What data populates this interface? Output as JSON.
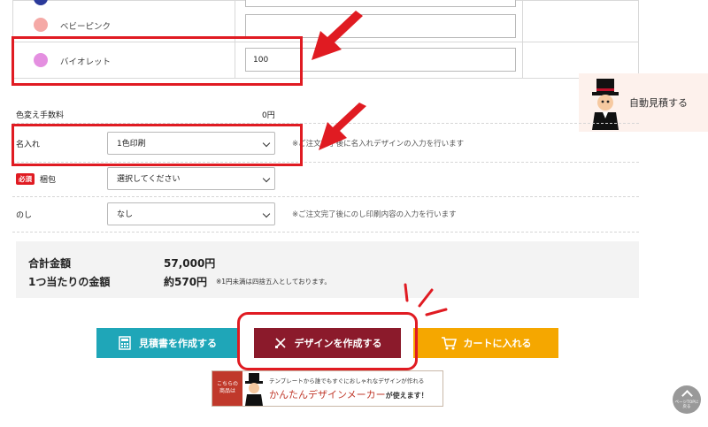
{
  "colors": {
    "rows": [
      {
        "name": "ベビーピンク",
        "swatch": "#f5a9a6",
        "value": ""
      },
      {
        "name": "バイオレット",
        "swatch": "#e48fe0",
        "value": "100"
      }
    ],
    "top_swatch": "#2b3a9a"
  },
  "auto_estimate": {
    "label": "自動見積する"
  },
  "form": {
    "fee_label": "色変え手数料",
    "fee_value": "0円",
    "print_label": "名入れ",
    "print_value": "1色印刷",
    "print_note": "※ご注文完了後に名入れデザインの入力を行います",
    "required_badge": "必須",
    "packing_label": "梱包",
    "packing_value": "選択してください",
    "noshi_label": "のし",
    "noshi_value": "なし",
    "noshi_note": "※ご注文完了後にのし印刷内容の入力を行います"
  },
  "summary": {
    "total_label": "合計金額",
    "total_value": "57,000円",
    "unit_label": "1つ当たりの金額",
    "unit_value": "約570円",
    "unit_note": "※1円未満は四捨五入としております。"
  },
  "buttons": {
    "estimate": "見積書を作成する",
    "design": "デザインを作成する",
    "cart": "カートに入れる"
  },
  "banner": {
    "badge": "こちらの\n商品は",
    "line1": "テンプレートから誰でもすぐにおしゃれなデザインが作れる",
    "line2_brand": "かんたんデザインメーカー",
    "line2_suffix": "が使えます！"
  },
  "page_top": {
    "label": "ページTOPに\n戻る"
  },
  "accent": {
    "red": "#e01b22",
    "teal": "#1fa6b8",
    "maroon": "#8b1a2b",
    "orange": "#f5a700"
  }
}
